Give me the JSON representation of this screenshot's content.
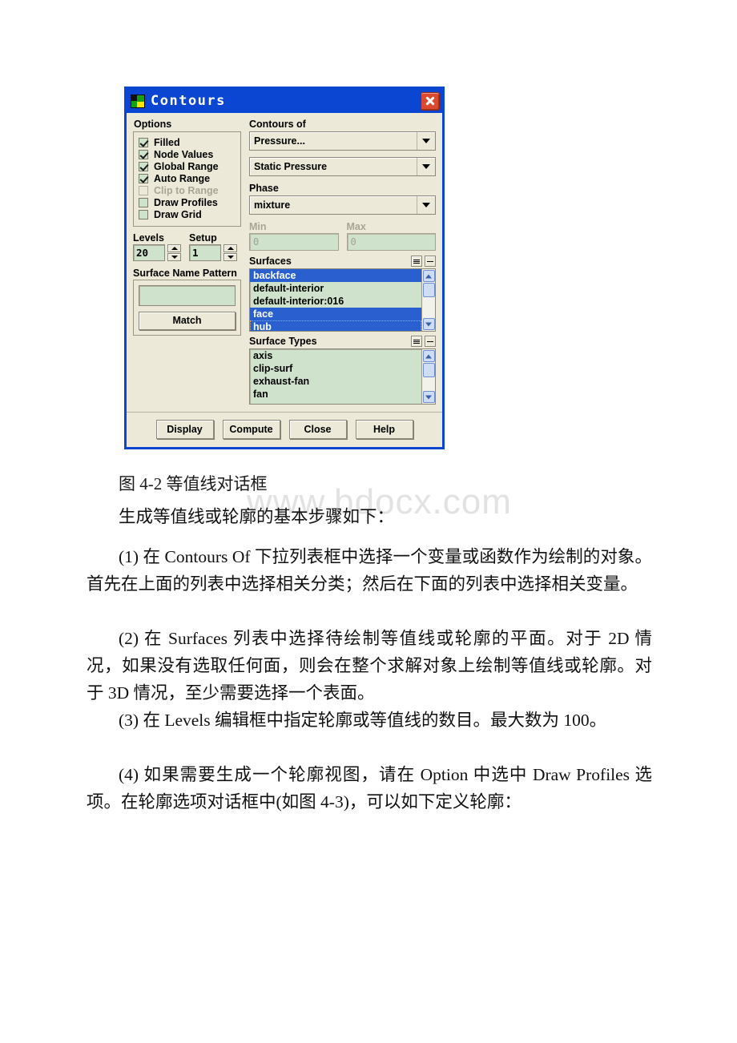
{
  "dialog": {
    "title": "Contours",
    "icon": "fluent-app-icon",
    "close_label": "×",
    "options": {
      "group_label": "Options",
      "items": [
        {
          "label": "Filled",
          "checked": true,
          "disabled": false
        },
        {
          "label": "Node Values",
          "checked": true,
          "disabled": false
        },
        {
          "label": "Global Range",
          "checked": true,
          "disabled": false
        },
        {
          "label": "Auto Range",
          "checked": true,
          "disabled": false
        },
        {
          "label": "Clip to Range",
          "checked": false,
          "disabled": true
        },
        {
          "label": "Draw Profiles",
          "checked": false,
          "disabled": false
        },
        {
          "label": "Draw Grid",
          "checked": false,
          "disabled": false
        }
      ]
    },
    "levels": {
      "label": "Levels",
      "value": "20"
    },
    "setup": {
      "label": "Setup",
      "value": "1"
    },
    "surface_name_pattern": {
      "label": "Surface Name Pattern",
      "value": "",
      "match_label": "Match"
    },
    "contours_of": {
      "label": "Contours of",
      "category_value": "Pressure...",
      "variable_value": "Static Pressure"
    },
    "phase": {
      "label": "Phase",
      "value": "mixture"
    },
    "range": {
      "min_label": "Min",
      "max_label": "Max",
      "min_value": "0",
      "max_value": "0"
    },
    "surfaces": {
      "label": "Surfaces",
      "items": [
        {
          "name": "backface",
          "selected": true
        },
        {
          "name": "default-interior",
          "selected": false
        },
        {
          "name": "default-interior:016",
          "selected": false
        },
        {
          "name": "face",
          "selected": true
        },
        {
          "name": "hub",
          "selected": true
        }
      ]
    },
    "surface_types": {
      "label": "Surface Types",
      "items": [
        {
          "name": "axis",
          "selected": false
        },
        {
          "name": "clip-surf",
          "selected": false
        },
        {
          "name": "exhaust-fan",
          "selected": false
        },
        {
          "name": "fan",
          "selected": false
        }
      ]
    },
    "buttons": [
      {
        "label": "Display"
      },
      {
        "label": "Compute"
      },
      {
        "label": "Close"
      },
      {
        "label": "Help"
      }
    ]
  },
  "document": {
    "watermark": "www.bdocx.com",
    "caption": "图 4-2 等值线对话框",
    "intro": "生成等值线或轮廓的基本步骤如下：",
    "steps": [
      "(1) 在 Contours Of 下拉列表框中选择一个变量或函数作为绘制的对象。首先在上面的列表中选择相关分类；然后在下面的列表中选择相关变量。",
      "(2) 在 Surfaces 列表中选择待绘制等值线或轮廓的平面。对于 2D 情况，如果没有选取任何面，则会在整个求解对象上绘制等值线或轮廓。对于 3D 情况，至少需要选择一个表面。",
      "(3) 在 Levels 编辑框中指定轮廓或等值线的数目。最大数为 100。",
      "(4) 如果需要生成一个轮廓视图，请在 Option 中选中 Draw Profiles 选项。在轮廓选项对话框中(如图 4-3)，可以如下定义轮廓："
    ]
  }
}
